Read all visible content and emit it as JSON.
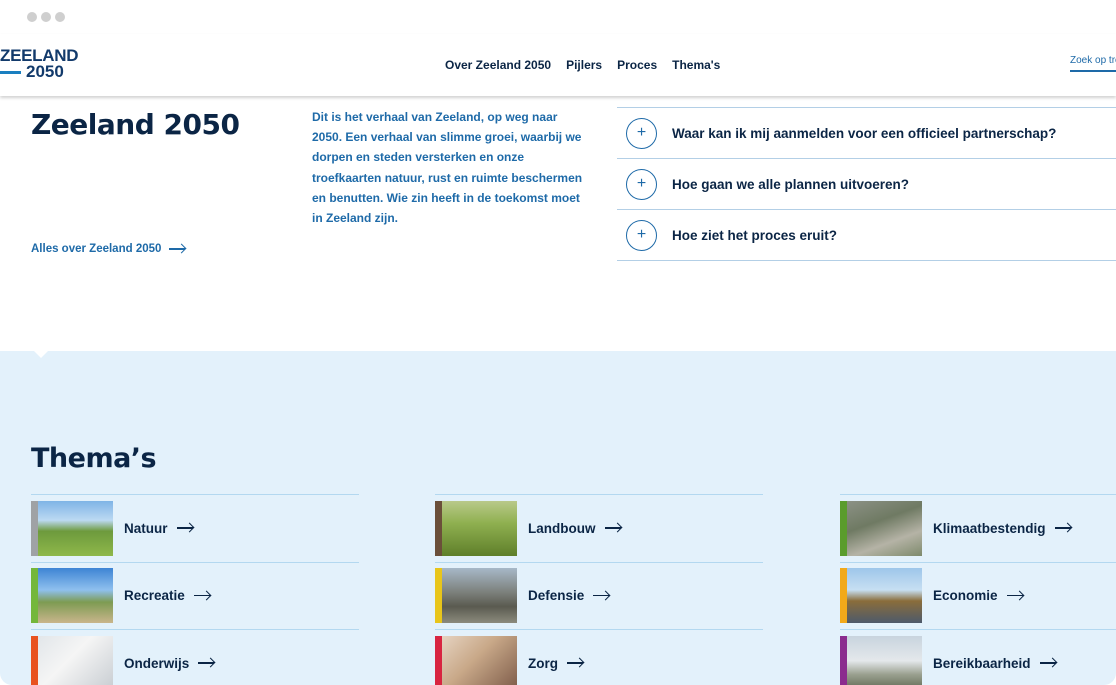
{
  "header": {
    "logo_top": "ZEELAND",
    "logo_bottom": "2050",
    "nav": [
      "Over Zeeland 2050",
      "Pijlers",
      "Proces",
      "Thema's"
    ],
    "search_placeholder": "Zoek op trefwoord"
  },
  "intro": {
    "title": "Zeeland 2050",
    "text": "Dit is het verhaal van Zeeland, op weg naar 2050. Een verhaal van slimme groei, waarbij we dorpen en steden versterken en onze troefkaarten natuur, rust en ruimte beschermen en benutten. Wie zin heeft in de toekomst moet in Zeeland zijn.",
    "link": "Alles over Zeeland 2050"
  },
  "faq": [
    "Waar kan ik mij aanmelden voor een officieel partnerschap?",
    "Hoe gaan we alle plannen uitvoeren?",
    "Hoe ziet het proces eruit?"
  ],
  "themes": {
    "title": "Thema’s",
    "items": [
      {
        "label": "Natuur",
        "color": "#9fa2a5",
        "icon": "landscape-photo"
      },
      {
        "label": "Recreatie",
        "color": "#74b73b",
        "icon": "cyclists-photo"
      },
      {
        "label": "Onderwijs",
        "color": "#e8521f",
        "icon": "lab-photo"
      },
      {
        "label": "Landbouw",
        "color": "#6b4f3a",
        "icon": "farmers-photo"
      },
      {
        "label": "Defensie",
        "color": "#e8c51a",
        "icon": "military-photo"
      },
      {
        "label": "Zorg",
        "color": "#d82440",
        "icon": "care-photo"
      },
      {
        "label": "Klimaatbestendig",
        "color": "#5a9c2c",
        "icon": "dike-photo"
      },
      {
        "label": "Economie",
        "color": "#f2a91a",
        "icon": "harbor-photo"
      },
      {
        "label": "Bereikbaarheid",
        "color": "#8b2c8e",
        "icon": "road-photo"
      }
    ]
  }
}
